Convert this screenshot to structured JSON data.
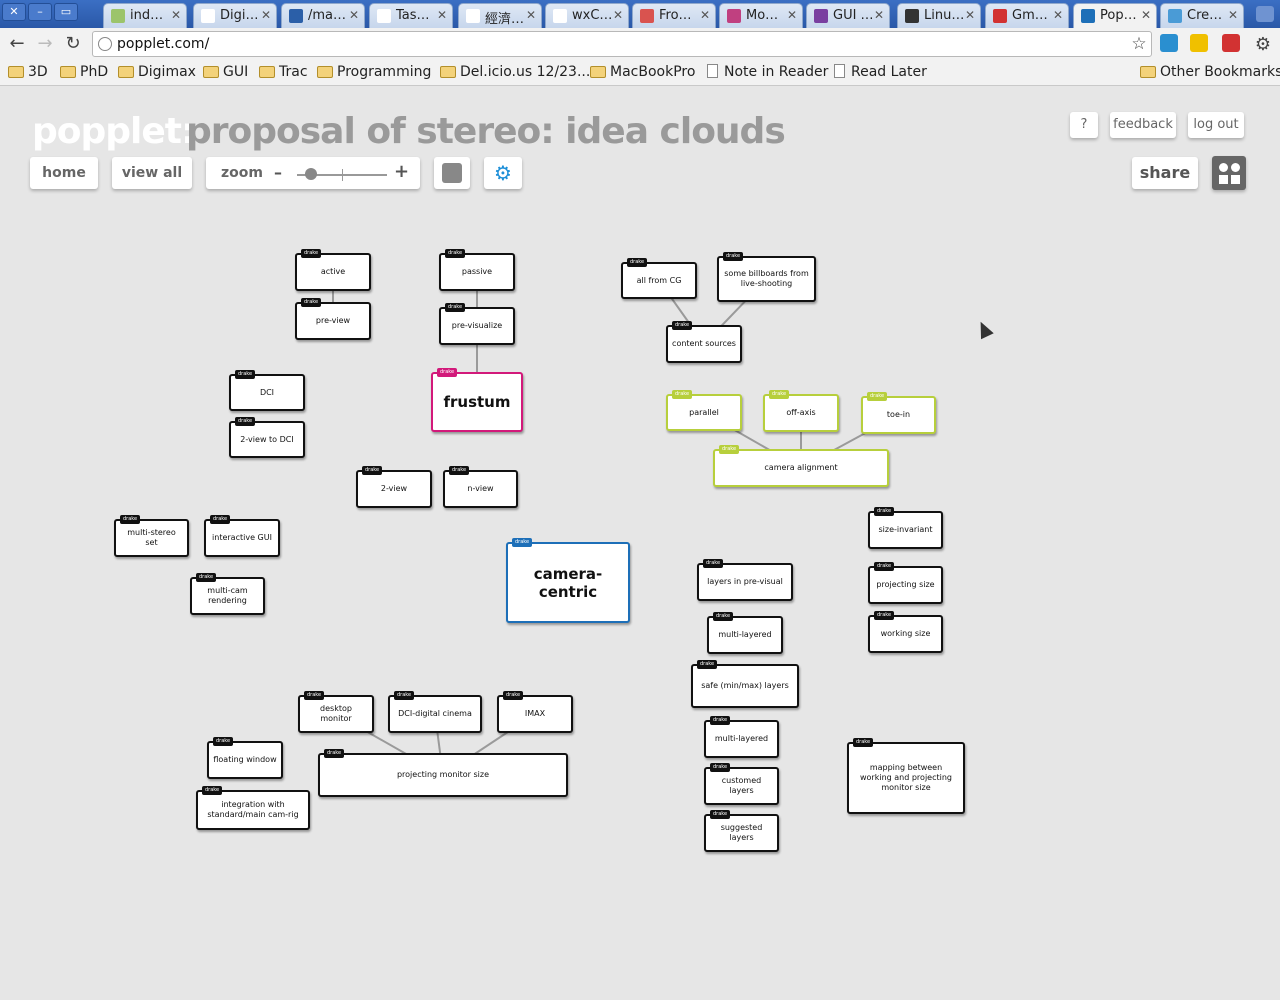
{
  "browser": {
    "tabs": [
      {
        "label": "ind…",
        "fav": "#9cc46b"
      },
      {
        "label": "Digi…",
        "fav": "#ffffff"
      },
      {
        "label": "/ma…",
        "fav": "#2b5fa8"
      },
      {
        "label": "Tas…",
        "fav": "#ffffff"
      },
      {
        "label": "經濟…",
        "fav": "#ffffff"
      },
      {
        "label": "wxC…",
        "fav": "#ffffff"
      },
      {
        "label": "Fro…",
        "fav": "#d9534f"
      },
      {
        "label": "Mo…",
        "fav": "#c04080"
      },
      {
        "label": "GUI …",
        "fav": "#7a3fa0"
      },
      {
        "label": "Linu…",
        "fav": "#333333"
      },
      {
        "label": "Gm…",
        "fav": "#d23232"
      },
      {
        "label": "Pop…",
        "fav": "#1d6fb8",
        "active": true
      },
      {
        "label": "Cre…",
        "fav": "#4a9bd6"
      }
    ],
    "url": "popplet.com/",
    "bookmarks": [
      {
        "label": "3D",
        "type": "folder"
      },
      {
        "label": "PhD",
        "type": "folder"
      },
      {
        "label": "Digimax",
        "type": "folder"
      },
      {
        "label": "GUI",
        "type": "folder"
      },
      {
        "label": "Trac",
        "type": "folder"
      },
      {
        "label": "Programming",
        "type": "folder"
      },
      {
        "label": "Del.icio.us 12/23...",
        "type": "folder"
      },
      {
        "label": "MacBookPro",
        "type": "folder"
      },
      {
        "label": "Note in Reader",
        "type": "page"
      },
      {
        "label": "Read Later",
        "type": "page"
      },
      {
        "label": "Other Bookmarks",
        "type": "folder"
      }
    ]
  },
  "app": {
    "brand": "popplet:",
    "title": "proposal of stereo: idea clouds",
    "buttons": {
      "home": "home",
      "view_all": "view all",
      "zoom": "zoom",
      "zoom_minus": "–",
      "zoom_plus": "+",
      "help": "?",
      "feedback": "feedback",
      "logout": "log out",
      "share": "share"
    },
    "zoom_level": 0.15,
    "author_tag": "drake",
    "nodes": [
      {
        "id": "active",
        "label": "active",
        "color": "black"
      },
      {
        "id": "pre-view",
        "label": "pre-view",
        "color": "black"
      },
      {
        "id": "passive",
        "label": "passive",
        "color": "black"
      },
      {
        "id": "pre-visualize",
        "label": "pre-visualize",
        "color": "black"
      },
      {
        "id": "frustum",
        "label": "frustum",
        "color": "pink"
      },
      {
        "id": "all-from-cg",
        "label": "all from CG",
        "color": "black"
      },
      {
        "id": "billboards",
        "label": "some billboards from live-shooting",
        "color": "black"
      },
      {
        "id": "content-sources",
        "label": "content sources",
        "color": "black"
      },
      {
        "id": "dci",
        "label": "DCI",
        "color": "black"
      },
      {
        "id": "2-view-to-dci",
        "label": "2-view to DCI",
        "color": "black"
      },
      {
        "id": "parallel",
        "label": "parallel",
        "color": "green"
      },
      {
        "id": "off-axis",
        "label": "off-axis",
        "color": "green"
      },
      {
        "id": "toe-in",
        "label": "toe-in",
        "color": "green"
      },
      {
        "id": "camera-alignment",
        "label": "camera alignment",
        "color": "green"
      },
      {
        "id": "2-view",
        "label": "2-view",
        "color": "black"
      },
      {
        "id": "n-view",
        "label": "n-view",
        "color": "black"
      },
      {
        "id": "multi-stereo-set",
        "label": "multi-stereo set",
        "color": "black"
      },
      {
        "id": "interactive-gui",
        "label": "interactive GUI",
        "color": "black"
      },
      {
        "id": "multi-cam-rendering",
        "label": "multi-cam rendering",
        "color": "black"
      },
      {
        "id": "camera-centric",
        "label": "camera-centric",
        "color": "blue"
      },
      {
        "id": "size-invariant",
        "label": "size-invariant",
        "color": "black"
      },
      {
        "id": "layers-pre-visual",
        "label": "layers in pre-visual",
        "color": "black"
      },
      {
        "id": "projecting-size",
        "label": "projecting size",
        "color": "black"
      },
      {
        "id": "multi-layered-1",
        "label": "multi-layered",
        "color": "black"
      },
      {
        "id": "working-size",
        "label": "working size",
        "color": "black"
      },
      {
        "id": "safe-layers",
        "label": "safe (min/max) layers",
        "color": "black"
      },
      {
        "id": "desktop-monitor",
        "label": "desktop monitor",
        "color": "black"
      },
      {
        "id": "dci-digital-cinema",
        "label": "DCI-digital cinema",
        "color": "black"
      },
      {
        "id": "imax",
        "label": "IMAX",
        "color": "black"
      },
      {
        "id": "multi-layered-2",
        "label": "multi-layered",
        "color": "black"
      },
      {
        "id": "floating-window",
        "label": "floating window",
        "color": "black"
      },
      {
        "id": "projecting-monitor-size",
        "label": "projecting monitor size",
        "color": "black"
      },
      {
        "id": "mapping",
        "label": "mapping between working and projecting monitor size",
        "color": "black"
      },
      {
        "id": "customed-layers",
        "label": "customed layers",
        "color": "black"
      },
      {
        "id": "integration",
        "label": "integration with standard/main cam-rig",
        "color": "black"
      },
      {
        "id": "suggested-layers",
        "label": "suggested layers",
        "color": "black"
      }
    ],
    "links": [
      [
        "active",
        "pre-view"
      ],
      [
        "passive",
        "pre-visualize"
      ],
      [
        "pre-visualize",
        "frustum"
      ],
      [
        "all-from-cg",
        "content-sources"
      ],
      [
        "billboards",
        "content-sources"
      ],
      [
        "parallel",
        "camera-alignment"
      ],
      [
        "off-axis",
        "camera-alignment"
      ],
      [
        "toe-in",
        "camera-alignment"
      ],
      [
        "desktop-monitor",
        "projecting-monitor-size"
      ],
      [
        "dci-digital-cinema",
        "projecting-monitor-size"
      ],
      [
        "imax",
        "projecting-monitor-size"
      ]
    ]
  }
}
